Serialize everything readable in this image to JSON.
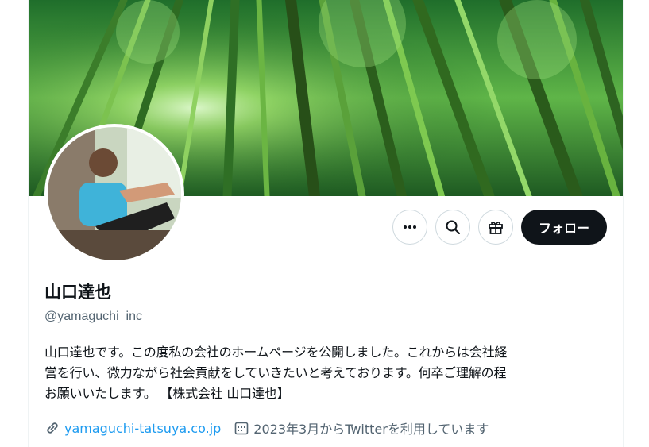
{
  "profile": {
    "display_name": "山口達也",
    "handle": "@yamaguchi_inc",
    "bio": "山口達也です。この度私の会社のホームページを公開しました。これからは会社経\n営を行い、微力ながら社会貢献をしていきたいと考えております。何卒ご理解の程\nお願いいたします。 【株式会社 山口達也】",
    "website": "yamaguchi-tatsuya.co.jp",
    "joined": "2023年3月からTwitterを利用しています"
  },
  "actions": {
    "more_icon": "more-icon",
    "search_icon": "search-icon",
    "gift_icon": "gift-icon",
    "follow_label": "フォロー"
  },
  "colors": {
    "accent_link": "#1d9bf0",
    "follow_bg": "#0f1419",
    "secondary_text": "#536471"
  }
}
